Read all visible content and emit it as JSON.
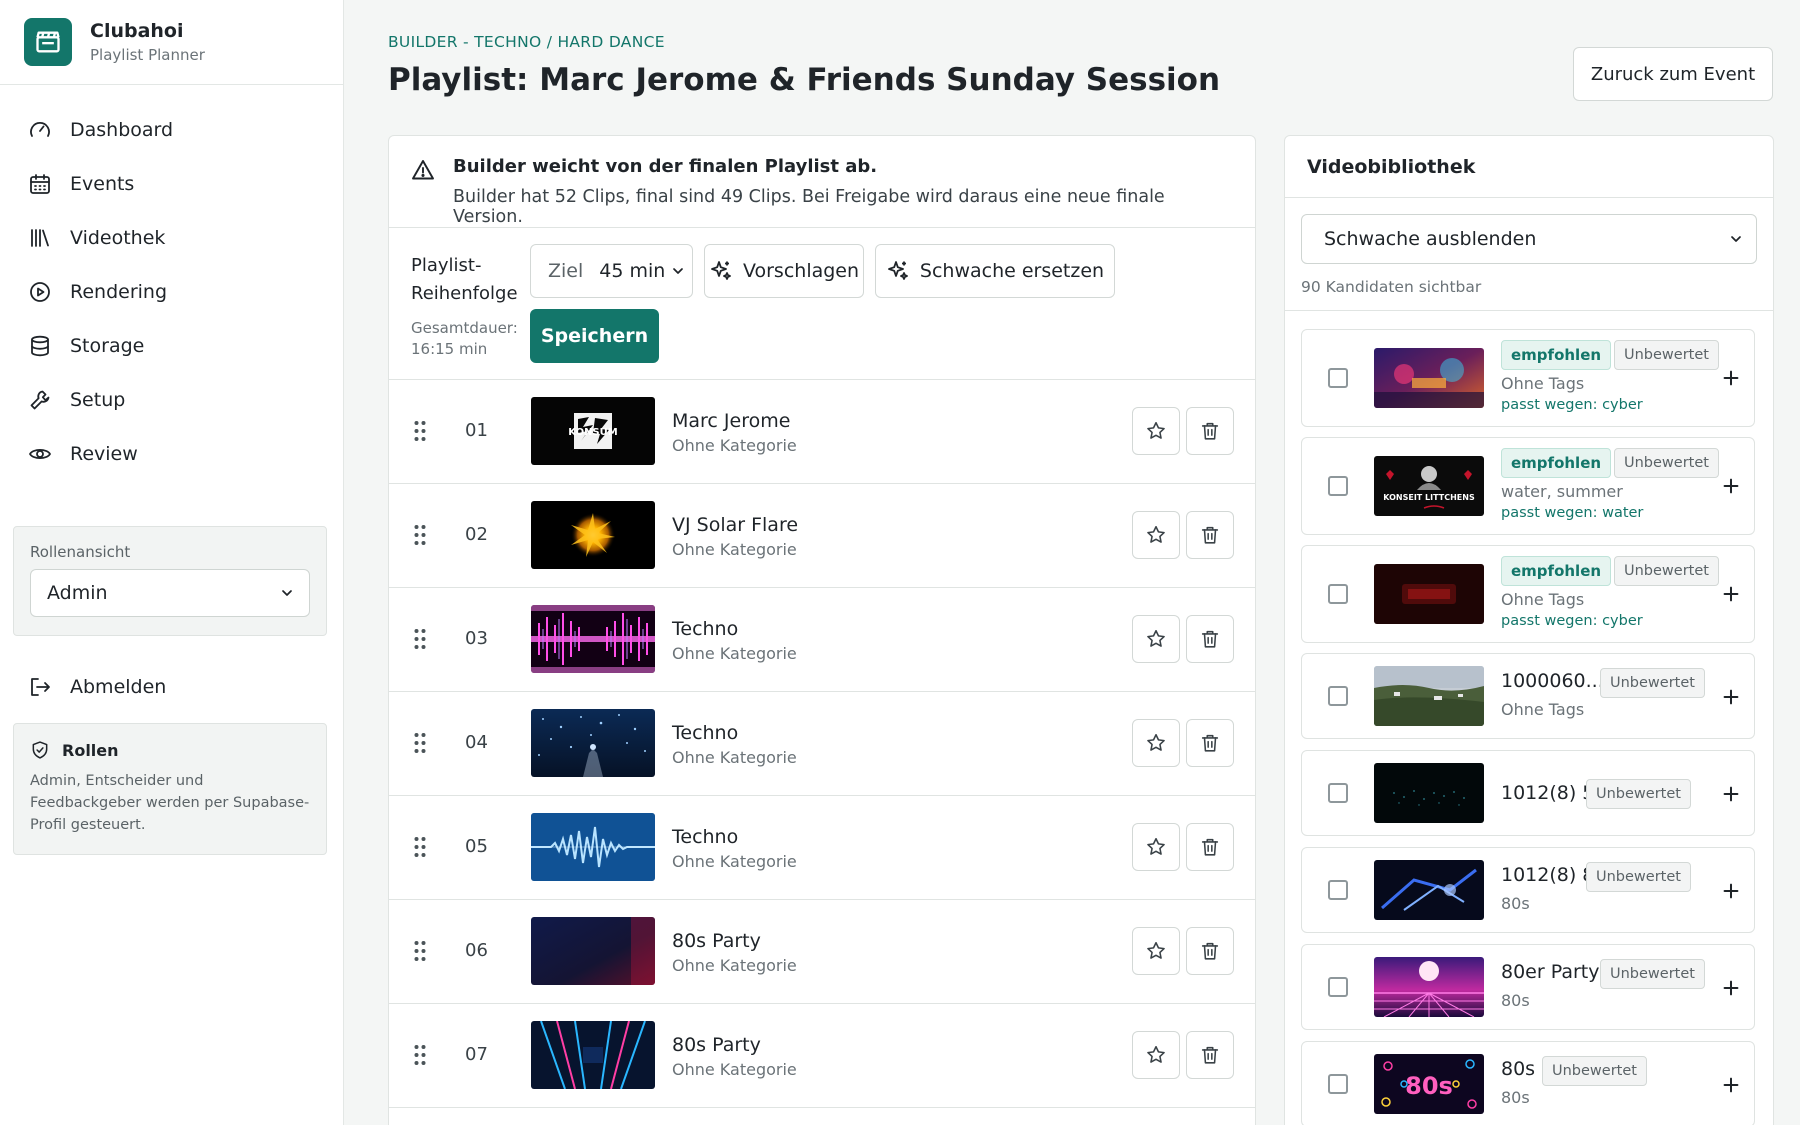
{
  "brand": {
    "name": "Clubahoi",
    "subtitle": "Playlist Planner",
    "accent": "#13766a"
  },
  "nav": [
    {
      "label": "Dashboard",
      "icon": "gauge-icon"
    },
    {
      "label": "Events",
      "icon": "calendar-icon"
    },
    {
      "label": "Videothek",
      "icon": "library-icon"
    },
    {
      "label": "Rendering",
      "icon": "play-circle-icon"
    },
    {
      "label": "Storage",
      "icon": "database-icon"
    },
    {
      "label": "Setup",
      "icon": "wrench-icon"
    },
    {
      "label": "Review",
      "icon": "eye-icon"
    }
  ],
  "role_view": {
    "label": "Rollenansicht",
    "selected": "Admin"
  },
  "logout": {
    "label": "Abmelden"
  },
  "roles_card": {
    "title": "Rollen",
    "text": "Admin, Entscheider und Feedbackgeber werden per Supabase-Profil gesteuert."
  },
  "header": {
    "breadcrumb": "BUILDER - TECHNO / HARD DANCE",
    "title": "Playlist: Marc Jerome & Friends Sunday Session",
    "back_label": "Zuruck zum Event"
  },
  "warning": {
    "title": "Builder weicht von der finalen Playlist ab.",
    "message": "Builder hat 52 Clips, final sind 49 Clips. Bei Freigabe wird daraus eine neue finale Version."
  },
  "controls": {
    "label": "Playlist-Reihenfolge",
    "duration_label": "Gesamtdauer:",
    "duration_value": "16:15 min",
    "target_label": "Ziel",
    "target_value": "45 min",
    "suggest_label": "Vorschlagen",
    "replace_label": "Schwache ersetzen",
    "save_label": "Speichern"
  },
  "playlist": [
    {
      "num": "01",
      "title": "Marc Jerome",
      "category": "Ohne Kategorie"
    },
    {
      "num": "02",
      "title": "VJ Solar Flare",
      "category": "Ohne Kategorie"
    },
    {
      "num": "03",
      "title": "Techno",
      "category": "Ohne Kategorie"
    },
    {
      "num": "04",
      "title": "Techno",
      "category": "Ohne Kategorie"
    },
    {
      "num": "05",
      "title": "Techno",
      "category": "Ohne Kategorie"
    },
    {
      "num": "06",
      "title": "80s Party",
      "category": "Ohne Kategorie"
    },
    {
      "num": "07",
      "title": "80s Party",
      "category": "Ohne Kategorie"
    }
  ],
  "library": {
    "title": "Videobibliothek",
    "filter_selected": "Schwache ausblenden",
    "count": "90 Kandidaten sichtbar",
    "items": [
      {
        "title": "",
        "tags": "Ohne Tags",
        "recommended": "empfohlen",
        "rating": "Unbewertet",
        "match": "passt wegen: cyber"
      },
      {
        "title": "",
        "tags": "water, summer",
        "recommended": "empfohlen",
        "rating": "Unbewertet",
        "match": "passt wegen: water"
      },
      {
        "title": "",
        "tags": "Ohne Tags",
        "recommended": "empfohlen",
        "rating": "Unbewertet",
        "match": "passt wegen: cyber"
      },
      {
        "title": "1000060...",
        "tags": "Ohne Tags",
        "recommended": "",
        "rating": "Unbewertet",
        "match": ""
      },
      {
        "title": "1012(8) 5",
        "tags": "",
        "recommended": "",
        "rating": "Unbewertet",
        "match": ""
      },
      {
        "title": "1012(8) 8",
        "tags": "80s",
        "recommended": "",
        "rating": "Unbewertet",
        "match": ""
      },
      {
        "title": "80er Party",
        "tags": "80s",
        "recommended": "",
        "rating": "Unbewertet",
        "match": ""
      },
      {
        "title": "80s",
        "tags": "80s",
        "recommended": "",
        "rating": "Unbewertet",
        "match": ""
      }
    ]
  },
  "thumb_text": {
    "item1": "KONSUM",
    "lib2": "KONSEIT LITTCHENS",
    "lib8": "80s"
  }
}
